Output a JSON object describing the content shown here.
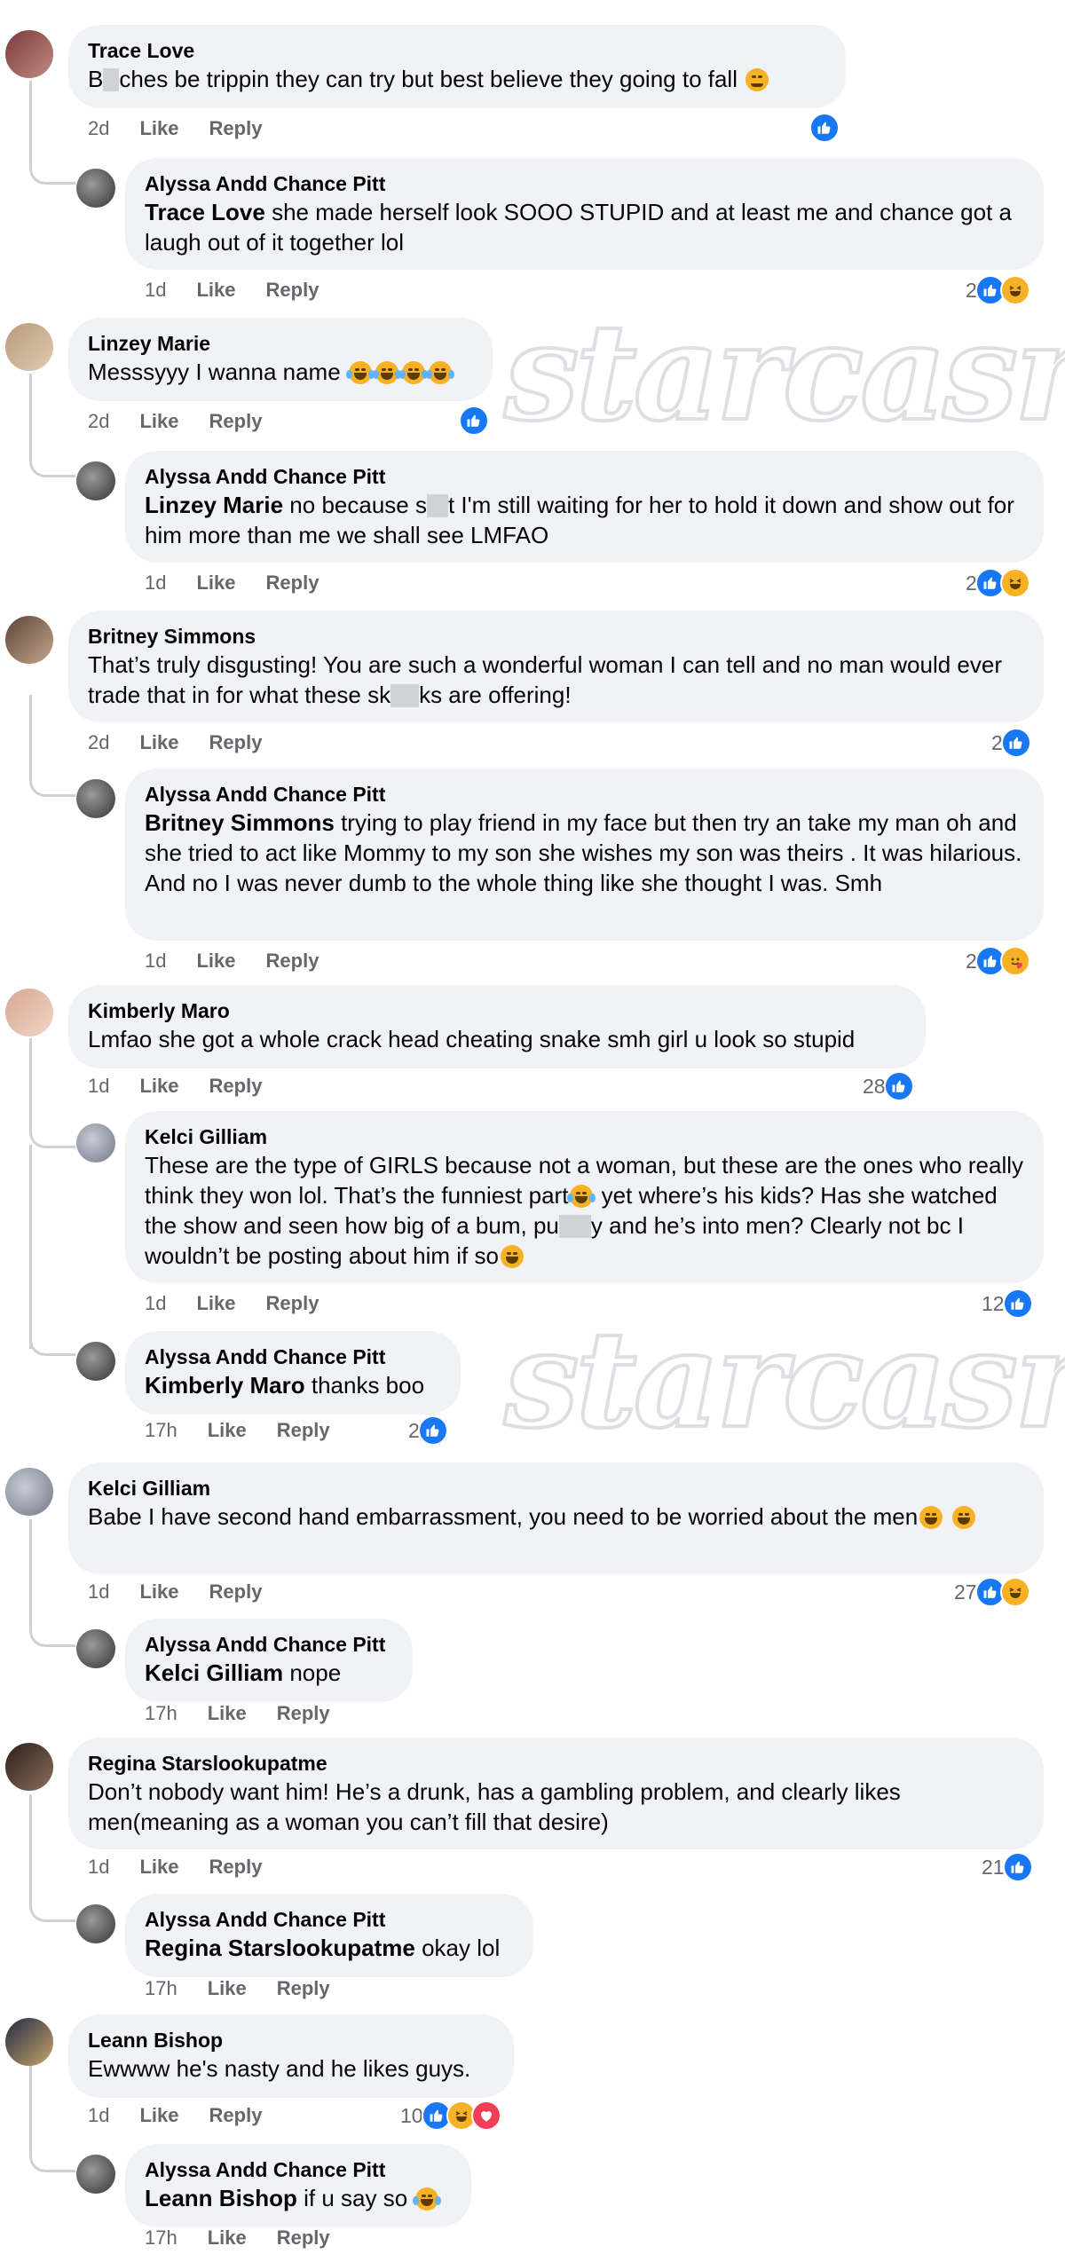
{
  "watermark": "starcasm",
  "labels": {
    "like": "Like",
    "reply": "Reply"
  },
  "comments": [
    {
      "name": "Trace Love",
      "text_parts": [
        "B",
        "ches be trippin they can try but best believe they going to fall"
      ],
      "time": "2d",
      "reactions": {
        "count": "",
        "icons": [
          "like-icon"
        ]
      },
      "replies": [
        {
          "name": "Alyssa Andd Chance Pitt",
          "tag": "Trace Love",
          "text": "she made herself look SOOO STUPID and at least me and chance got a laugh out of it together lol",
          "time": "1d",
          "reactions": {
            "count": "2",
            "icons": [
              "like-icon",
              "haha-icon"
            ]
          }
        }
      ]
    },
    {
      "name": "Linzey Marie",
      "text": "Messsyyy I wanna name",
      "time": "2d",
      "reactions": {
        "count": "",
        "icons": [
          "like-icon"
        ]
      },
      "replies": [
        {
          "name": "Alyssa Andd Chance Pitt",
          "tag": "Linzey Marie",
          "text_parts": [
            "no because s",
            "t I'm still waiting for her to hold it down and show out for him more than me we shall see LMFAO"
          ],
          "time": "1d",
          "reactions": {
            "count": "2",
            "icons": [
              "like-icon",
              "haha-icon"
            ]
          }
        }
      ]
    },
    {
      "name": "Britney Simmons",
      "text_parts": [
        "That’s truly disgusting! You are such a wonderful woman I can tell and no man would ever trade that in for what these sk",
        "ks are offering!"
      ],
      "time": "2d",
      "reactions": {
        "count": "2",
        "icons": [
          "like-icon"
        ]
      },
      "replies": [
        {
          "name": "Alyssa Andd Chance Pitt",
          "tag": "Britney Simmons",
          "text": "trying to play friend in my face but then try an take my man oh and she tried to act like Mommy to my son she wishes my son was theirs . It was hilarious. And no I was never dumb to the whole thing like she thought I was. Smh",
          "time": "1d",
          "reactions": {
            "count": "2",
            "icons": [
              "like-icon",
              "care-icon"
            ]
          }
        }
      ]
    },
    {
      "name": "Kimberly Maro",
      "text": "Lmfao she got a whole crack head cheating snake smh girl u look so stupid",
      "time": "1d",
      "reactions": {
        "count": "28",
        "icons": [
          "like-icon"
        ]
      },
      "replies": [
        {
          "name": "Kelci Gilliam",
          "text_parts": [
            "These are the type of GIRLS because not a woman, but these are the ones who really think they won lol. That’s the funniest part",
            " yet where’s his kids? Has she watched the show and seen how big of a bum, pu",
            "y and he’s into men? Clearly not bc I wouldn’t be posting about him if so"
          ],
          "time": "1d",
          "reactions": {
            "count": "12",
            "icons": [
              "like-icon"
            ]
          }
        },
        {
          "name": "Alyssa Andd Chance Pitt",
          "tag": "Kimberly Maro",
          "text": "thanks boo",
          "time": "17h",
          "reactions": {
            "count": "2",
            "icons": [
              "like-icon"
            ]
          }
        }
      ]
    },
    {
      "name": "Kelci Gilliam",
      "text": "Babe I have second hand embarrassment, you need to be worried about the men",
      "time": "1d",
      "reactions": {
        "count": "27",
        "icons": [
          "like-icon",
          "haha-icon"
        ]
      },
      "replies": [
        {
          "name": "Alyssa Andd Chance Pitt",
          "tag": "Kelci Gilliam",
          "text": "nope",
          "time": "17h",
          "reactions": {
            "count": "",
            "icons": []
          }
        }
      ]
    },
    {
      "name": "Regina Starslookupatme",
      "text": "Don’t nobody want him! He’s a drunk, has a gambling problem, and clearly likes men(meaning as a woman you can’t fill that desire)",
      "time": "1d",
      "reactions": {
        "count": "21",
        "icons": [
          "like-icon"
        ]
      },
      "replies": [
        {
          "name": "Alyssa Andd Chance Pitt",
          "tag": "Regina Starslookupatme",
          "text": "okay lol",
          "time": "17h",
          "reactions": {
            "count": "",
            "icons": []
          }
        }
      ]
    },
    {
      "name": "Leann Bishop",
      "text": "Ewwww he's nasty and he likes guys.",
      "time": "1d",
      "reactions": {
        "count": "10",
        "icons": [
          "like-icon",
          "haha-icon",
          "heart-icon"
        ]
      },
      "replies": [
        {
          "name": "Alyssa Andd Chance Pitt",
          "tag": "Leann Bishop",
          "text": "if u say so",
          "time": "17h",
          "reactions": {
            "count": "",
            "icons": []
          }
        }
      ]
    }
  ]
}
